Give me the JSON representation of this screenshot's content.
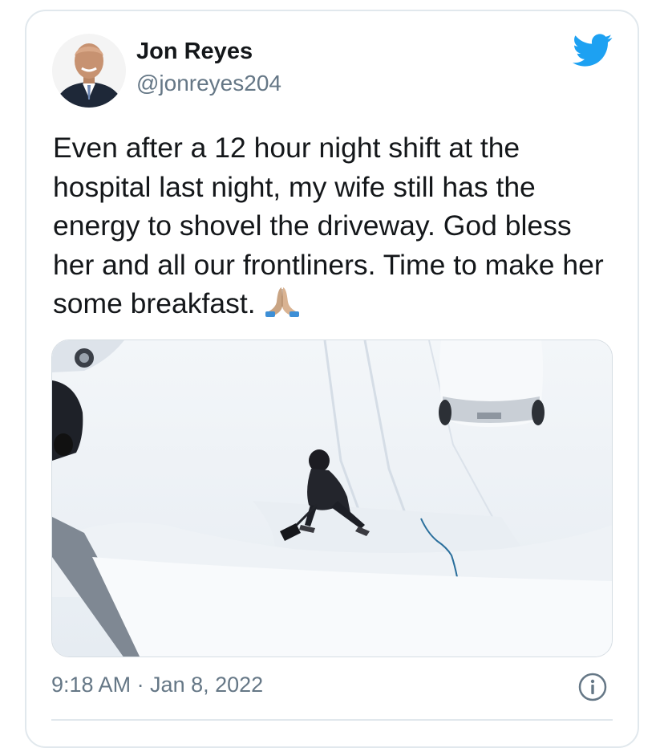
{
  "tweet": {
    "author": {
      "name": "Jon Reyes",
      "handle": "@jonreyes204"
    },
    "text": "Even after a 12 hour night shift at the hospital last night, my wife still has the energy to shovel the driveway. God bless her and all our frontliners. Time to make her some breakfast.",
    "emoji": "folded-hands-emoji",
    "timestamp": "9:18 AM · Jan 8, 2022",
    "brand_color": "#1da1f2"
  },
  "icons": {
    "logo": "twitter-bird-icon",
    "info": "info-icon"
  }
}
